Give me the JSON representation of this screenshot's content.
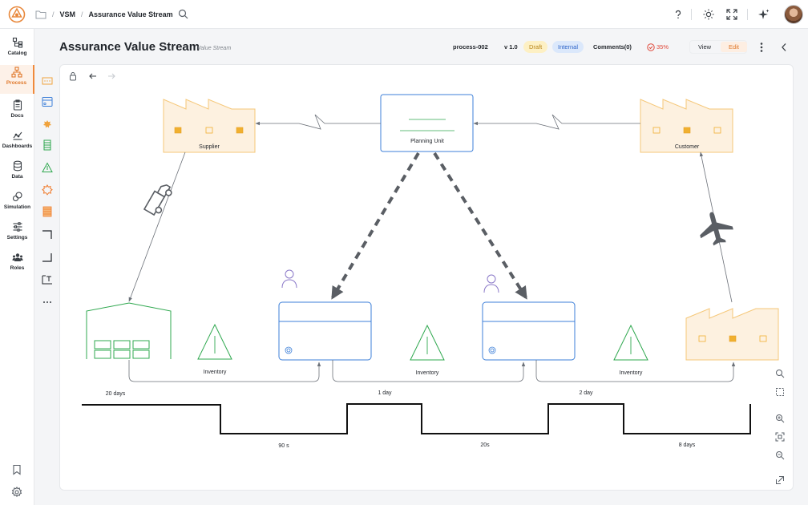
{
  "breadcrumb": {
    "items": [
      "VSM",
      "Assurance Value Stream"
    ]
  },
  "sidebar": {
    "items": [
      {
        "label": "Catalog"
      },
      {
        "label": "Process"
      },
      {
        "label": "Docs"
      },
      {
        "label": "Dashboards"
      },
      {
        "label": "Data"
      },
      {
        "label": "Simulation"
      },
      {
        "label": "Settings"
      },
      {
        "label": "Roles"
      }
    ]
  },
  "header": {
    "title": "Assurance Value Stream",
    "subtitle": "Value Stream",
    "process_id": "process-002",
    "version": "v 1.0",
    "status": "Draft",
    "visibility": "Internal",
    "comments": "Comments(0)",
    "progress": "35%",
    "view_label": "View",
    "edit_label": "Edit"
  },
  "diagram": {
    "supplier": "Supplier",
    "planning_unit": "Planning Unit",
    "customer": "Customer",
    "inventory_labels": [
      "Inventory",
      "Inventory",
      "Inventory"
    ],
    "timeline_top": [
      "20 days",
      "1 day",
      "2 day"
    ],
    "timeline_bottom": [
      "90 s",
      "20s",
      "8 days"
    ]
  },
  "colors": {
    "accent": "#f08a3c",
    "factory_fill": "#fdf1e0",
    "factory_stroke": "#f5c778",
    "process_stroke": "#3c7fd8",
    "green": "#2fa84f",
    "draft": "#b9861a",
    "internal": "#2d64c8",
    "progress": "#e0493b"
  }
}
